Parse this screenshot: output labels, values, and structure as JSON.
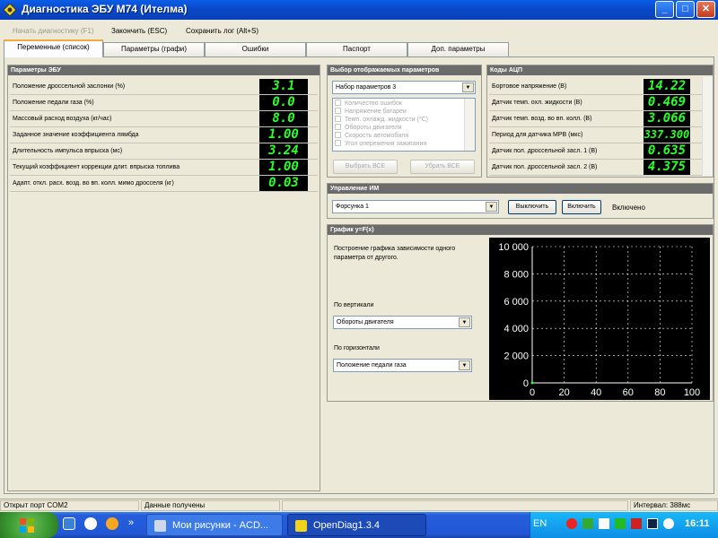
{
  "window": {
    "title": "Диагностика ЭБУ М74 (Ителма)"
  },
  "menu": {
    "start_diag": "Начать диагностику (F1)",
    "finish": "Закончить (ESC)",
    "save_log": "Сохранить лог (Alt+S)"
  },
  "tabs": [
    {
      "label": "Переменные (список)"
    },
    {
      "label": "Параметры (графи)"
    },
    {
      "label": "Ошибки"
    },
    {
      "label": "Паспорт"
    },
    {
      "label": "Доп. параметры"
    }
  ],
  "ecu": {
    "title": "Параметры ЭБУ",
    "rows": [
      {
        "label": "Положение дроссельной заслонки (%)",
        "value": "3.1"
      },
      {
        "label": "Положение педали газа (%)",
        "value": "0.0"
      },
      {
        "label": "Массовый расход воздуха (кг/час)",
        "value": "8.0"
      },
      {
        "label": "Заданное значение коэффициента лямбда",
        "value": "1.00"
      },
      {
        "label": "Длительность импульса впрыска (мс)",
        "value": "3.24"
      },
      {
        "label": "Текущий коэффициент коррекции длит. впрыска топлива",
        "value": "1.00"
      },
      {
        "label": "Адапт. откл. расх. возд. во вп. колл. мимо дросселя (кг)",
        "value": "0.03"
      }
    ]
  },
  "select_params": {
    "title": "Выбор отображаемых параметров",
    "set_value": "Набор параметров 3",
    "items": [
      "Количество ошибок",
      "Напряжение батареи",
      "Темп. охлажд. жидкости (°С)",
      "Обороты двигателя",
      "Скорость автомобиля",
      "Угол опережения зажигания"
    ],
    "select_all": "Выбрать ВСЕ",
    "remove_all": "Убрать ВСЕ"
  },
  "adc": {
    "title": "Коды АЦП",
    "rows": [
      {
        "label": "Бортовое напряжение (В)",
        "value": "14.22"
      },
      {
        "label": "Датчик темп. охл. жидкости (В)",
        "value": "0.469"
      },
      {
        "label": "Датчик темп. возд. во вп. колл. (В)",
        "value": "3.066"
      },
      {
        "label": "Период для датчика МРВ (мкс)",
        "value": "337.300"
      },
      {
        "label": "Датчик пол. дроссельной засл. 1 (В)",
        "value": "0.635"
      },
      {
        "label": "Датчик пол. дроссельной засл. 2 (В)",
        "value": "4.375"
      }
    ]
  },
  "control": {
    "title": "Управление ИМ",
    "device": "Форсунка 1",
    "off_label": "Выключить",
    "on_label": "Включить",
    "state": "Включено"
  },
  "graph": {
    "title": "График y=F(x)",
    "description": "Построение графика зависимости одного параметра от другого.",
    "vertical_label": "По вертикали",
    "vertical_value": "Обороты двигателя",
    "horizontal_label": "По горизонтали",
    "horizontal_value": "Положение педали газа"
  },
  "chart_data": {
    "type": "scatter",
    "x": [
      0
    ],
    "y": [
      0
    ],
    "xlim": [
      0,
      100
    ],
    "ylim": [
      0,
      10000
    ],
    "x_ticks": [
      "0",
      "20",
      "40",
      "60",
      "80",
      "100"
    ],
    "y_ticks": [
      "0",
      "2 000",
      "4 000",
      "6 000",
      "8 000",
      "10 000"
    ],
    "grid": true,
    "background": "#000000",
    "grid_color": "#ffffff",
    "tick_color": "#ffffff"
  },
  "status": {
    "port": "Открыт порт COM2",
    "data": "Данные получены",
    "interval": "Интервал: 388мс"
  },
  "taskbar": {
    "task1": "Мои рисунки - ACD...",
    "task2": "OpenDiag1.3.4",
    "lang": "EN",
    "clock": "16:11"
  },
  "colors": {
    "lcd_green": "#2bff2b",
    "titlebar": "#0b48c8",
    "taskbar": "#245edb"
  }
}
